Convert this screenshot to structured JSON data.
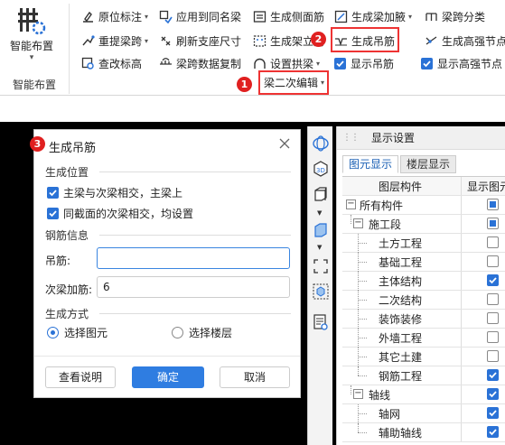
{
  "ribbon": {
    "big_button": {
      "label": "智能布置",
      "icon": "smart-layout-icon"
    },
    "group_label": "智能布置",
    "col1": [
      "原位标注",
      "重提梁跨",
      "查改标高"
    ],
    "col2": [
      "应用到同名梁",
      "刷新支座尺寸",
      "梁跨数据复制"
    ],
    "col3": [
      "生成侧面筋",
      "生成架立筋",
      "设置拱梁"
    ],
    "col4": [
      "生成梁加腋",
      "生成吊筋",
      "显示吊筋"
    ],
    "col5": [
      "梁跨分类",
      "生成高强节点",
      "显示高强节点"
    ],
    "beam_edit": "梁二次编辑",
    "badges": [
      "1",
      "2",
      "3"
    ],
    "highlight_color": "#e33333"
  },
  "dialog": {
    "title": "生成吊筋",
    "section_position": "生成位置",
    "checkbox_main": "主梁与次梁相交，主梁上",
    "checkbox_same": "同截面的次梁相交，均设置",
    "section_rebar": "钢筋信息",
    "hanger_label": "吊筋:",
    "hanger_value": "",
    "stirrup_label": "次梁加筋:",
    "stirrup_value": "6",
    "section_method": "生成方式",
    "radio_element": "选择图元",
    "radio_floor": "选择楼层",
    "btn_help": "查看说明",
    "btn_ok": "确定",
    "btn_cancel": "取消"
  },
  "panel": {
    "title": "显示设置",
    "tabs": [
      "图元显示",
      "楼层显示"
    ],
    "col_header_1": "图层构件",
    "col_header_2": "显示图元",
    "rows": [
      "所有构件",
      "施工段",
      "土方工程",
      "基础工程",
      "主体结构",
      "二次结构",
      "装饰装修",
      "外墙工程",
      "其它土建",
      "钢筋工程",
      "轴线",
      "轴网",
      "辅助轴线"
    ]
  },
  "colors": {
    "accent": "#2a72d6",
    "badge": "#e02020",
    "primary_button": "#2f7de1"
  }
}
